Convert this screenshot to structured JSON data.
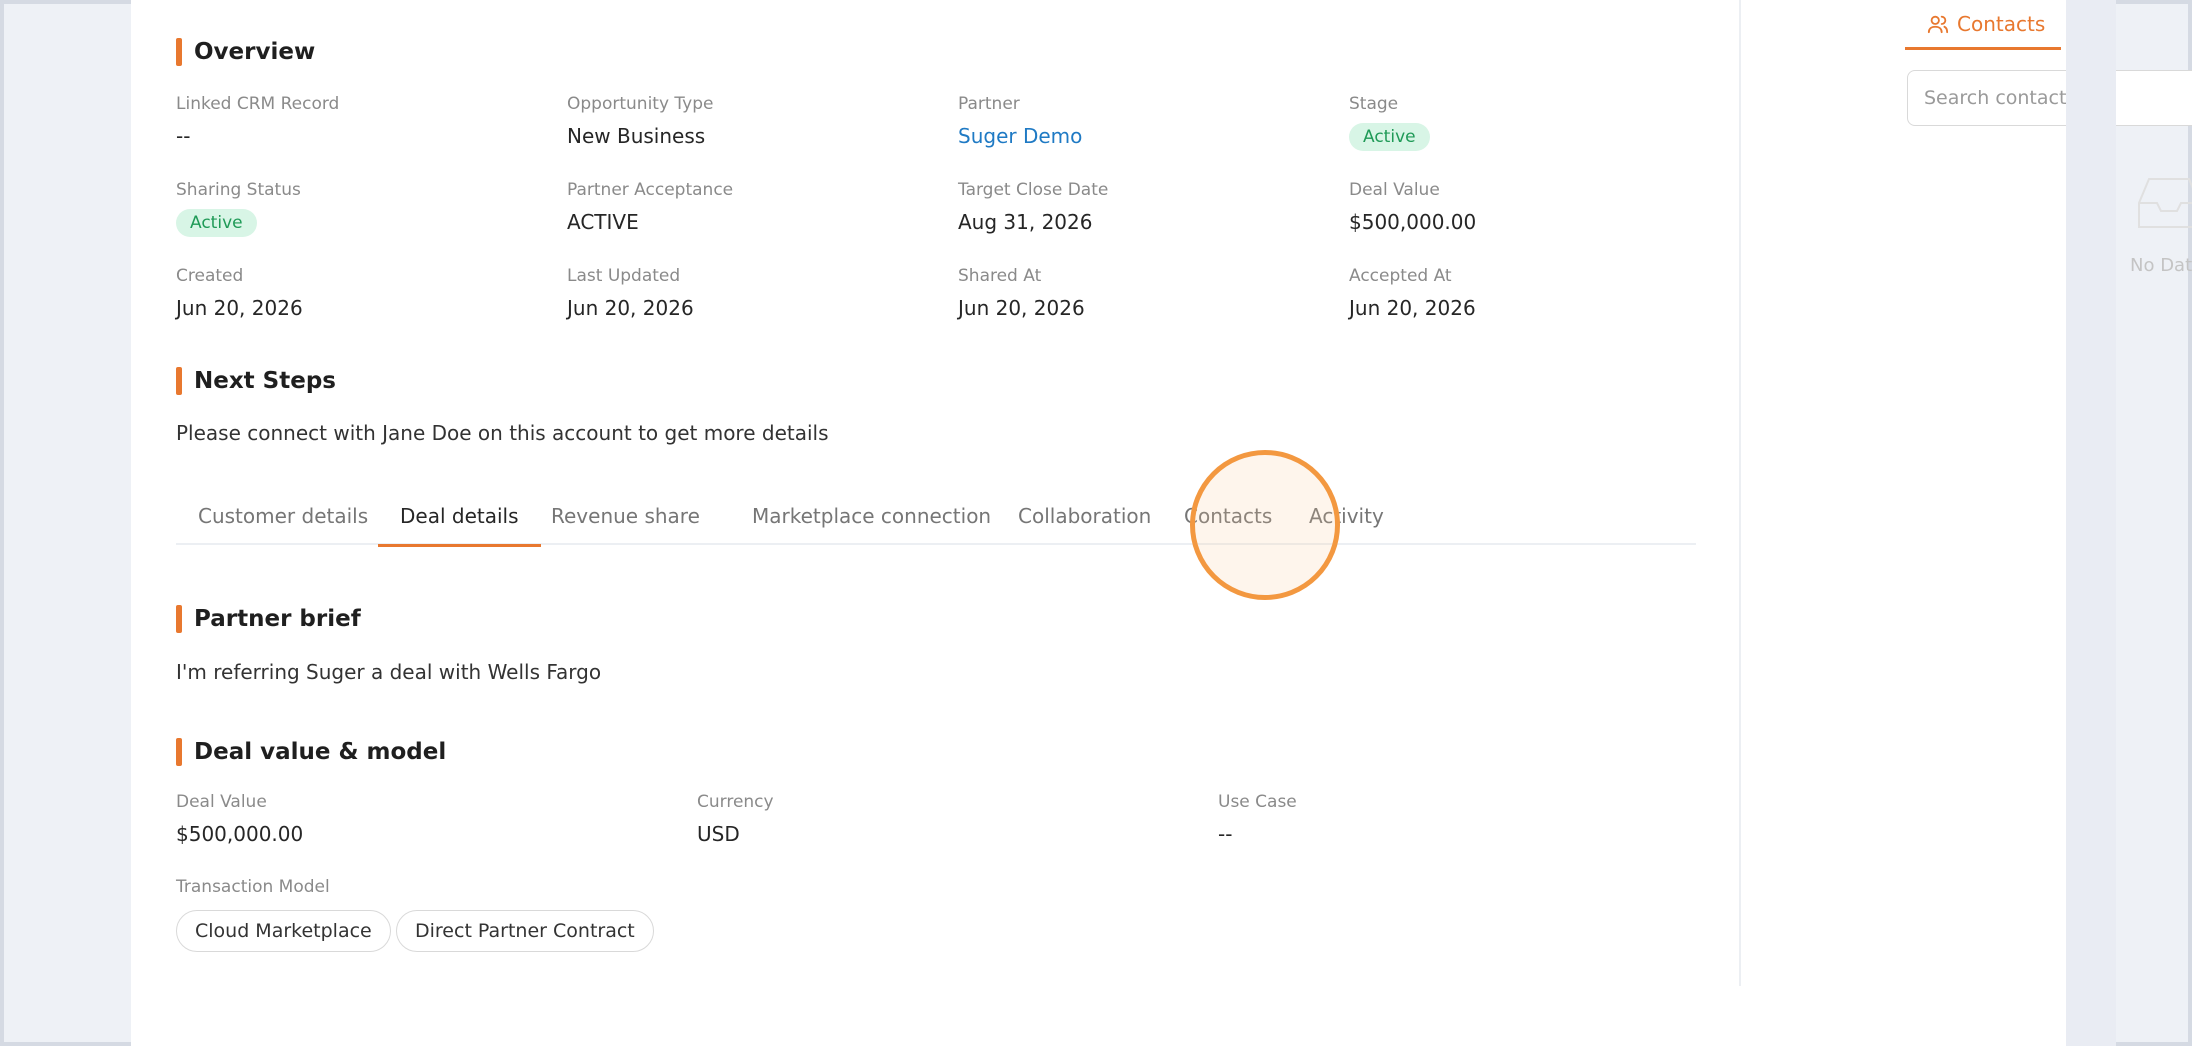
{
  "overview": {
    "title": "Overview",
    "fields": [
      {
        "label": "Linked CRM Record",
        "value": "--"
      },
      {
        "label": "Opportunity Type",
        "value": "New Business"
      },
      {
        "label": "Partner",
        "value": "Suger Demo"
      },
      {
        "label": "Stage",
        "value": "Active"
      },
      {
        "label": "Sharing Status",
        "value": "Active"
      },
      {
        "label": "Partner Acceptance",
        "value": "ACTIVE"
      },
      {
        "label": "Target Close Date",
        "value": "Aug 31, 2026"
      },
      {
        "label": "Deal Value",
        "value": "$500,000.00"
      },
      {
        "label": "Created",
        "value": "Jun 20, 2026"
      },
      {
        "label": "Last Updated",
        "value": "Jun 20, 2026"
      },
      {
        "label": "Shared At",
        "value": "Jun 20, 2026"
      },
      {
        "label": "Accepted At",
        "value": "Jun 20, 2026"
      }
    ]
  },
  "next_steps": {
    "title": "Next Steps",
    "text": "Please connect with Jane Doe on this account to get more details"
  },
  "tabs": [
    {
      "label": "Customer details",
      "active": false
    },
    {
      "label": "Deal details",
      "active": true
    },
    {
      "label": "Revenue share",
      "active": false
    },
    {
      "label": "Marketplace connection",
      "active": false
    },
    {
      "label": "Collaboration",
      "active": false
    },
    {
      "label": "Contacts",
      "active": false
    },
    {
      "label": "Activity",
      "active": false
    }
  ],
  "partner_brief": {
    "title": "Partner brief",
    "text": "I'm referring Suger a deal with Wells Fargo"
  },
  "deal_value_model": {
    "title": "Deal value & model",
    "fields": [
      {
        "label": "Deal Value",
        "value": "$500,000.00"
      },
      {
        "label": "Currency",
        "value": "USD"
      },
      {
        "label": "Use Case",
        "value": "--"
      }
    ],
    "transaction_model_label": "Transaction Model",
    "transaction_models": [
      "Cloud Marketplace",
      "Direct Partner Contract"
    ]
  },
  "sidebar": {
    "tab_label": "Contacts",
    "search_placeholder": "Search contacts...",
    "empty_text": "No Data"
  },
  "colors": {
    "accent": "#e8782f",
    "link": "#1f7ac4",
    "success_bg": "#d8f5e6",
    "success_text": "#1f9a57"
  }
}
